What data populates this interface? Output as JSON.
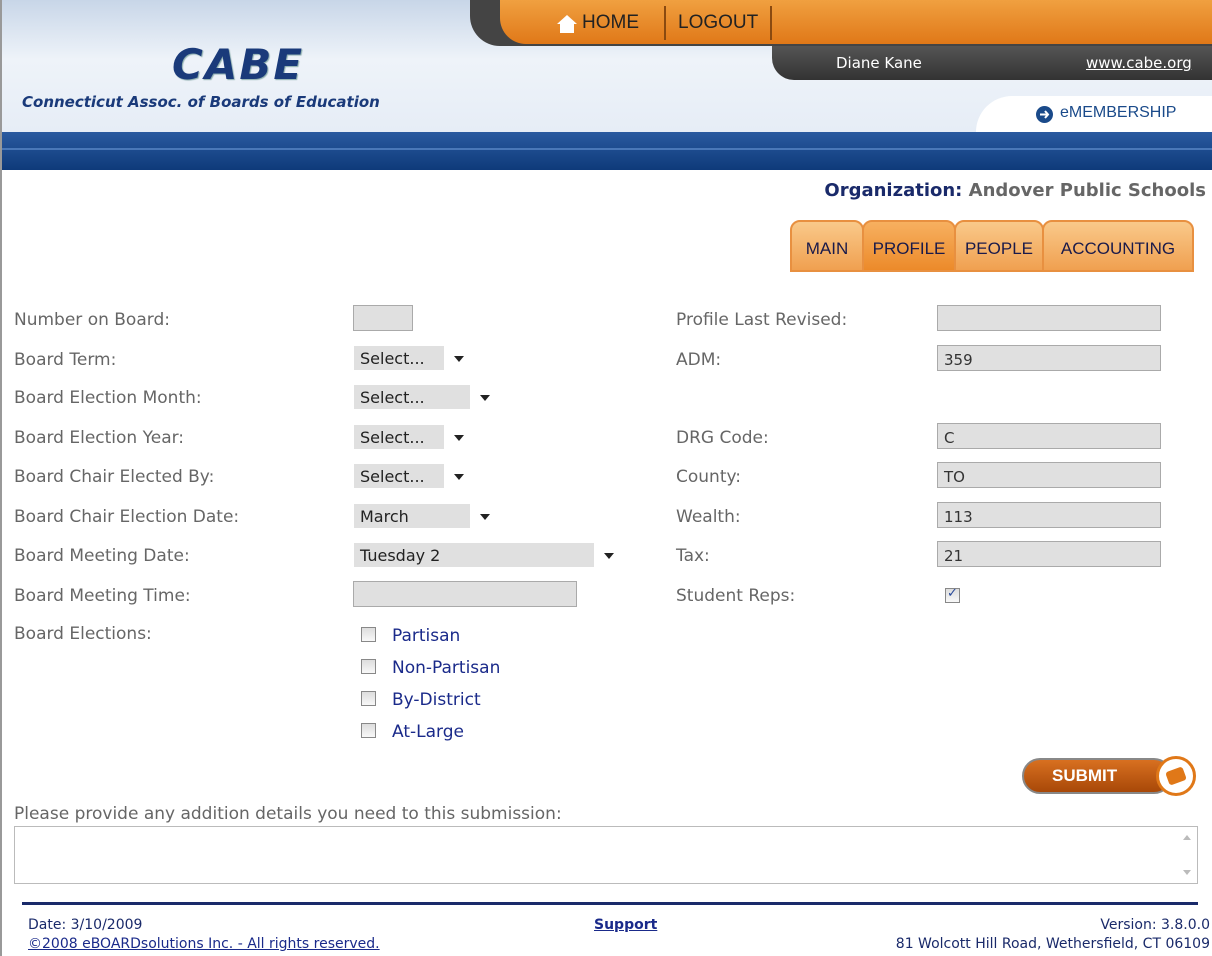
{
  "header": {
    "logo": "CABE",
    "logo_subtitle": "Connecticut Assoc. of Boards of Education",
    "nav_home": "HOME",
    "nav_logout": "LOGOUT",
    "user_name": "Diane Kane",
    "site_link": "www.cabe.org",
    "membership": "eMEMBERSHIP"
  },
  "organization": {
    "label": "Organization:",
    "name": "Andover Public Schools"
  },
  "tabs": [
    {
      "label": "MAIN"
    },
    {
      "label": "PROFILE"
    },
    {
      "label": "PEOPLE"
    },
    {
      "label": "ACCOUNTING"
    }
  ],
  "form_left": {
    "number_on_board": {
      "label": "Number on Board:",
      "value": ""
    },
    "board_term": {
      "label": "Board Term:",
      "value": "Select..."
    },
    "election_month": {
      "label": "Board Election Month:",
      "value": "Select..."
    },
    "election_year": {
      "label": "Board Election Year:",
      "value": "Select..."
    },
    "chair_elected_by": {
      "label": "Board Chair Elected By:",
      "value": "Select..."
    },
    "chair_election_date": {
      "label": "Board Chair Election Date:",
      "value": "March"
    },
    "meeting_date": {
      "label": "Board Meeting Date:",
      "value": "Tuesday 2"
    },
    "meeting_time": {
      "label": "Board Meeting Time:",
      "value": ""
    },
    "elections": {
      "label": "Board Elections:",
      "options": [
        {
          "label": "Partisan",
          "checked": false
        },
        {
          "label": "Non-Partisan",
          "checked": false
        },
        {
          "label": "By-District",
          "checked": false
        },
        {
          "label": "At-Large",
          "checked": false
        }
      ]
    }
  },
  "form_right": {
    "profile_last_revised": {
      "label": "Profile Last Revised:",
      "value": ""
    },
    "adm": {
      "label": "ADM:",
      "value": "359"
    },
    "drg_code": {
      "label": "DRG Code:",
      "value": "C"
    },
    "county": {
      "label": "County:",
      "value": "TO"
    },
    "wealth": {
      "label": "Wealth:",
      "value": "113"
    },
    "tax": {
      "label": "Tax:",
      "value": "21"
    },
    "student_reps": {
      "label": "Student Reps:",
      "checked": true
    }
  },
  "submit_label": "SUBMIT",
  "details": {
    "label": "Please provide any addition details you need to this submission:",
    "value": ""
  },
  "footer": {
    "date": "Date: 3/10/2009",
    "copyright": "©2008 eBOARDsolutions Inc. - All rights reserved.",
    "support": "Support",
    "version": "Version: 3.8.0.0",
    "address": "81 Wolcott Hill Road, Wethersfield, CT 06109"
  },
  "colors": {
    "accent_orange": "#e07818",
    "brand_blue": "#1a3a7a"
  }
}
